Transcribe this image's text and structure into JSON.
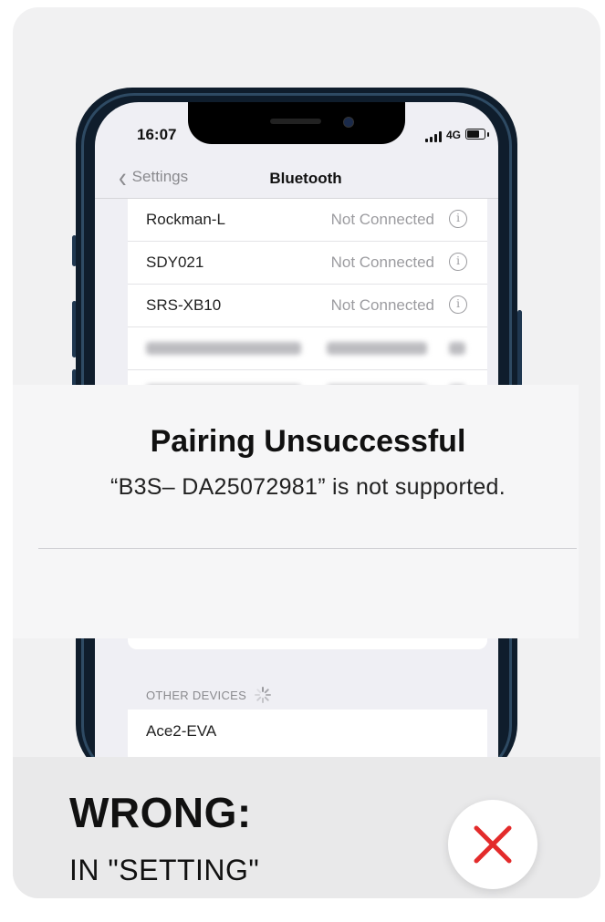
{
  "status_bar": {
    "time": "16:07",
    "network": "4G"
  },
  "nav": {
    "back_label": "Settings",
    "title": "Bluetooth"
  },
  "my_devices": [
    {
      "name": "Rockman-L",
      "status": "Not Connected"
    },
    {
      "name": "SDY021",
      "status": "Not Connected"
    },
    {
      "name": "SRS-XB10",
      "status": "Not Connected"
    }
  ],
  "dialog": {
    "title": "Pairing Unsuccessful",
    "message": "“B3S– DA25072981” is not supported."
  },
  "other_devices": {
    "header": "OTHER DEVICES",
    "items": [
      {
        "name": "Ace2-EVA"
      }
    ]
  },
  "caption": {
    "title": "WRONG:",
    "subtitle": "IN \"SETTING\""
  },
  "icons": {
    "back": "chevron-left-icon",
    "info": "info-icon",
    "spinner": "loading-spinner-icon",
    "wrong": "close-x-icon"
  },
  "colors": {
    "wrong_x": "#e32b2b",
    "phone_frame": "#0f1d2c",
    "card_bg": "#f1f1f2"
  }
}
